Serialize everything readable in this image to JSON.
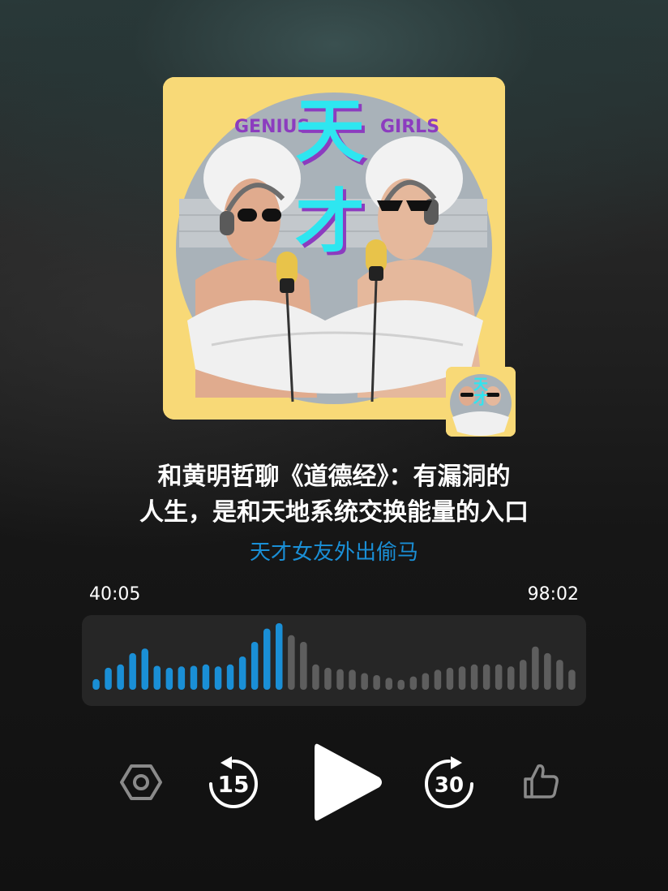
{
  "episode": {
    "title_line1": "和黄明哲聊《道德经》：有漏洞的",
    "title_line2": "人生，是和天地系统交换能量的入口",
    "podcast_name": "天才女友外出偷马"
  },
  "cover": {
    "logo_text": "天才",
    "left_text": "GENIUS",
    "right_text": "GIRLS"
  },
  "player": {
    "elapsed": "40:05",
    "duration": "98:02",
    "progress": 0.41,
    "rewind_seconds": "15",
    "forward_seconds": "30",
    "waveform": [
      0.16,
      0.33,
      0.38,
      0.55,
      0.62,
      0.36,
      0.33,
      0.35,
      0.36,
      0.38,
      0.35,
      0.38,
      0.5,
      0.72,
      0.92,
      1.0,
      0.82,
      0.72,
      0.38,
      0.33,
      0.31,
      0.3,
      0.25,
      0.22,
      0.18,
      0.15,
      0.2,
      0.25,
      0.3,
      0.33,
      0.35,
      0.38,
      0.38,
      0.38,
      0.35,
      0.45,
      0.65,
      0.55,
      0.45,
      0.3
    ],
    "colors": {
      "played": "#1a8fd6",
      "unplayed": "#5e5e5e",
      "icon": "#8a8a8a",
      "play": "#ffffff"
    }
  },
  "icons": {
    "settings": "hexagon-settings-icon",
    "rewind": "rewind-15-icon",
    "play": "play-icon",
    "forward": "forward-30-icon",
    "like": "thumbs-up-icon"
  }
}
